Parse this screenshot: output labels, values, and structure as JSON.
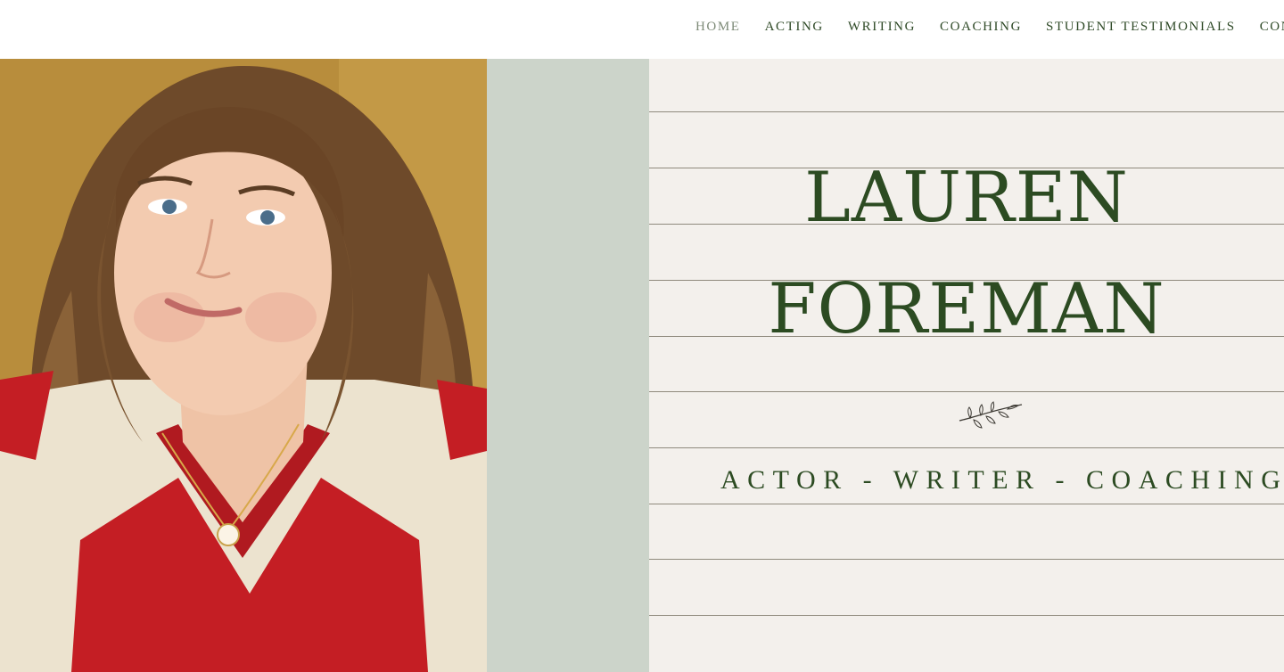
{
  "nav": {
    "items": [
      {
        "label": "HOME",
        "active": true
      },
      {
        "label": "ACTING",
        "active": false
      },
      {
        "label": "WRITING",
        "active": false
      },
      {
        "label": "COACHING",
        "active": false
      },
      {
        "label": "STUDENT TESTIMONIALS",
        "active": false
      },
      {
        "label": "CONTA",
        "active": false
      }
    ]
  },
  "hero": {
    "first_name": "LAUREN",
    "last_name": "FOREMAN",
    "tagline": "ACTOR - WRITER - COACHING",
    "ornament_icon": "leaf-sprig-icon",
    "portrait_icon": "portrait-photo"
  },
  "colors": {
    "accent_green": "#2c4b22",
    "sage": "#ccd4ca",
    "paper": "#f3f0ec",
    "photo_backdrop": "#b88d3c"
  }
}
